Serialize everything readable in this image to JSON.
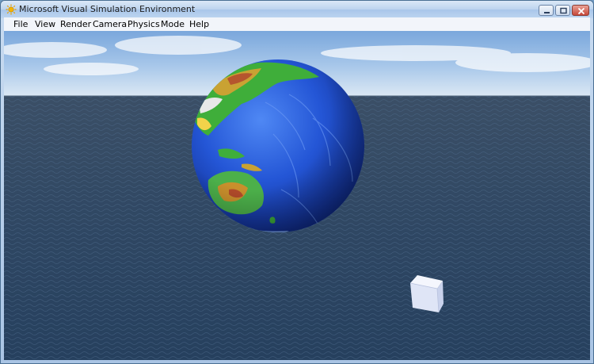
{
  "window": {
    "title": "Microsoft Visual Simulation Environment"
  },
  "menu": {
    "items": [
      {
        "label": "File",
        "name": "menu-file"
      },
      {
        "label": "View",
        "name": "menu-view"
      },
      {
        "label": "Render",
        "name": "menu-render"
      },
      {
        "label": "Camera",
        "name": "menu-camera"
      },
      {
        "label": "Physics",
        "name": "menu-physics"
      },
      {
        "label": "Mode",
        "name": "menu-mode"
      },
      {
        "label": "Help",
        "name": "menu-help"
      }
    ]
  },
  "scene": {
    "objects": [
      "sky",
      "ocean",
      "globe",
      "cube"
    ],
    "colors": {
      "sky_top": "#7aa7dc",
      "sky_horizon": "#dbe8f4",
      "ocean": "#2f4763",
      "globe_ocean": "#1f4fd0",
      "cube": "#e6ecfb"
    }
  }
}
